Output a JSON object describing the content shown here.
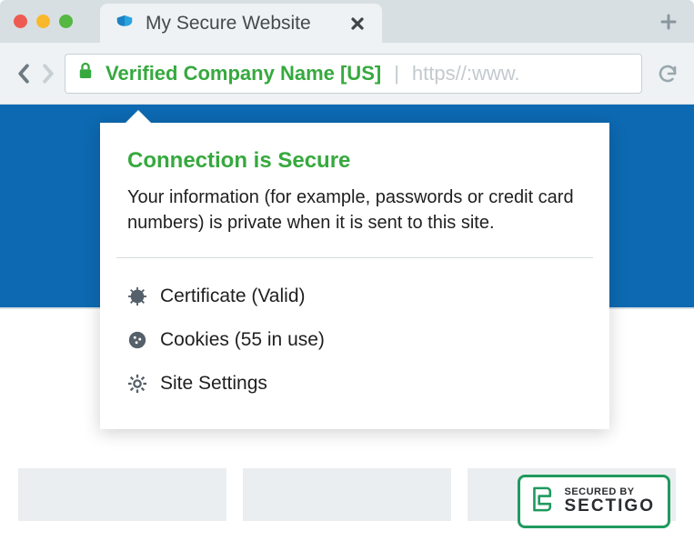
{
  "tab": {
    "title": "My Secure Website"
  },
  "address": {
    "company": "Verified Company Name [US]",
    "separator": "|",
    "url_preview": "https//:www."
  },
  "popover": {
    "title": "Connection is Secure",
    "description": "Your information (for example, passwords or credit card numbers) is private when it is sent to this site.",
    "items": [
      {
        "label": "Certificate (Valid)"
      },
      {
        "label": "Cookies (55 in use)"
      },
      {
        "label": "Site Settings"
      }
    ]
  },
  "seal": {
    "top": "SECURED BY",
    "bottom": "SECTIGO"
  },
  "colors": {
    "accent_green": "#36a93e",
    "brand_blue": "#0d69b1",
    "seal_green": "#1f9a5e"
  }
}
